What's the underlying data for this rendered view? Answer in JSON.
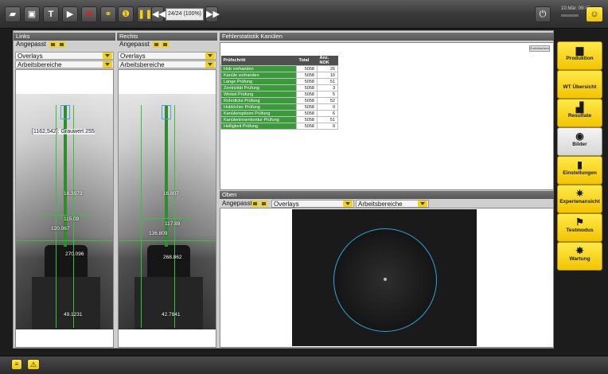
{
  "toolbar": {
    "zoom_value": "24/24 (100%)",
    "clock_time": "10.Mär. 09:47"
  },
  "panels": {
    "links": {
      "title": "Links",
      "mode": "Angepasst",
      "overlays": "Overlays",
      "areas": "Arbeitsbereiche"
    },
    "rechts": {
      "title": "Rechts",
      "mode": "Angepasst",
      "overlays": "Overlays",
      "areas": "Arbeitsbereiche"
    }
  },
  "links_image": {
    "annotation": "[1162,542]: Grauwert 255",
    "measure_1": "16.3973",
    "measure_2": "115.09",
    "measure_3": "120.067",
    "measure_4": "270.096",
    "measure_5": "49.1231"
  },
  "rechts_image": {
    "measure_1": "16.807",
    "measure_2": "117.89",
    "measure_3": "136.809",
    "measure_4": "268.862",
    "measure_5": "42.7841"
  },
  "stats": {
    "title": "Fehlerstatistik Kanülen",
    "zoom_btn": "Zurücksetzen",
    "columns": [
      "Prüfschritt",
      "Total",
      "Anz. NOK"
    ],
    "rows": [
      [
        "Hub vorhanden",
        "5058",
        "26"
      ],
      [
        "Kanüle vorhanden",
        "5058",
        "10"
      ],
      [
        "Länge Prüfung",
        "5058",
        "51"
      ],
      [
        "Zentrizität Prüfung",
        "5058",
        "3"
      ],
      [
        "Winkel Prüfung",
        "5058",
        "5"
      ],
      [
        "Rohrdicke Prüfung",
        "5058",
        "52"
      ],
      [
        "Hublöcher Prüfung",
        "5058",
        "0"
      ],
      [
        "Kanülenspitzen Prüfung",
        "5058",
        "6"
      ],
      [
        "Kanüleninnenkontur Prüfung",
        "5058",
        "51"
      ],
      [
        "Helligkeit Prüfung",
        "5058",
        "0"
      ]
    ]
  },
  "oben": {
    "title": "Oben",
    "mode": "Angepasst",
    "overlays": "Overlays",
    "areas": "Arbeitsbereiche"
  },
  "side_buttons": [
    "Produktion",
    "WT Übersicht",
    "Resultate",
    "Bilder",
    "Einstellungen",
    "Expertenansicht",
    "Testmodus",
    "Wartung"
  ],
  "colors": {
    "accent_yellow": "#f7d211",
    "pass_green": "#3a9b3a",
    "overlay_blue": "#2aa6d8"
  }
}
